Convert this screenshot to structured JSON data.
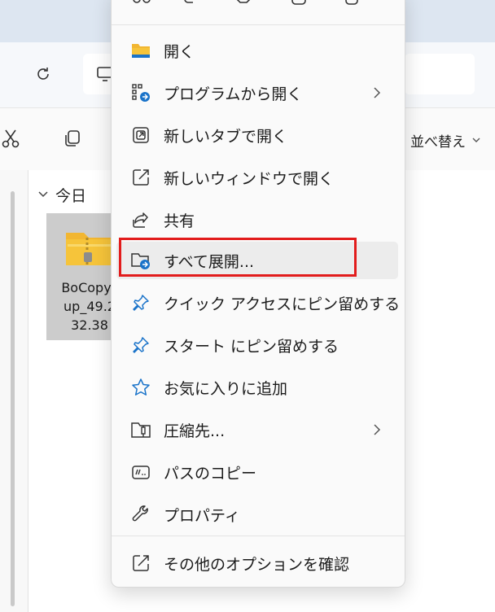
{
  "toolbar": {
    "sort_label": "並べ替え"
  },
  "content": {
    "group_header": "今日",
    "file": {
      "name_line1": "BoCopy_",
      "name_line2": "up_49.2",
      "name_line3": "32.38"
    }
  },
  "context_menu": {
    "quick_actions": [
      "cut-icon",
      "copy-icon",
      "share-icon",
      "rename-icon",
      "delete-icon"
    ],
    "items": [
      {
        "label": "開く",
        "icon": "folder-open-icon"
      },
      {
        "label": "プログラムから開く",
        "icon": "open-with-icon",
        "submenu": true
      },
      {
        "label": "新しいタブで開く",
        "icon": "new-tab-icon"
      },
      {
        "label": "新しいウィンドウで開く",
        "icon": "new-window-icon"
      },
      {
        "label": "共有",
        "icon": "share-icon"
      },
      {
        "label": "すべて展開...",
        "icon": "extract-all-icon",
        "highlighted": true
      },
      {
        "label": "クイック アクセスにピン留めする",
        "icon": "pin-icon"
      },
      {
        "label": "スタート にピン留めする",
        "icon": "pin-icon"
      },
      {
        "label": "お気に入りに追加",
        "icon": "star-icon"
      },
      {
        "label": "圧縮先...",
        "icon": "compress-icon",
        "submenu": true
      },
      {
        "label": "パスのコピー",
        "icon": "copy-path-icon"
      },
      {
        "label": "プロパティ",
        "icon": "wrench-icon"
      },
      {
        "label": "その他のオプションを確認",
        "icon": "more-options-icon"
      }
    ]
  },
  "colors": {
    "highlight_frame": "#e21c1c",
    "accent_blue": "#1a73c9",
    "folder_yellow": "#f6c43a"
  }
}
